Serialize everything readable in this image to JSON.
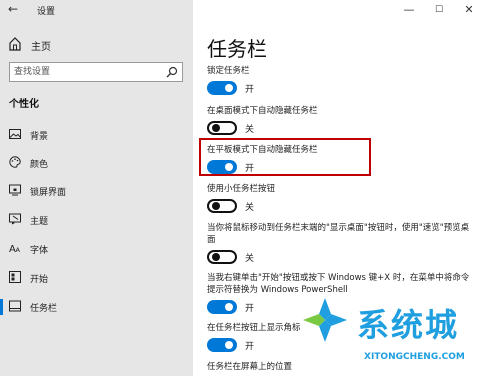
{
  "window": {
    "title": "设置",
    "back_icon": "back-arrow-icon"
  },
  "sidebar": {
    "home_label": "主页",
    "search_placeholder": "查找设置",
    "section_title": "个性化",
    "items": [
      {
        "label": "背景",
        "icon": "image-icon"
      },
      {
        "label": "颜色",
        "icon": "palette-icon"
      },
      {
        "label": "锁屏界面",
        "icon": "lock-screen-icon"
      },
      {
        "label": "主题",
        "icon": "theme-icon"
      },
      {
        "label": "字体",
        "icon": "font-icon"
      },
      {
        "label": "开始",
        "icon": "start-icon"
      },
      {
        "label": "任务栏",
        "icon": "taskbar-icon",
        "selected": true
      }
    ]
  },
  "main": {
    "title": "任务栏",
    "settings": [
      {
        "label": "锁定任务栏",
        "state": "开",
        "on": true
      },
      {
        "label": "在桌面模式下自动隐藏任务栏",
        "state": "关",
        "on": false
      },
      {
        "label": "在平板模式下自动隐藏任务栏",
        "state": "开",
        "on": true,
        "highlighted": true
      },
      {
        "label": "使用小任务栏按钮",
        "state": "关",
        "on": false
      },
      {
        "label": "当你将鼠标移动到任务栏末端的\"显示桌面\"按钮时，使用\"速览\"预览桌面",
        "state": "关",
        "on": false
      },
      {
        "label": "当我右键单击\"开始\"按钮或按下 Windows 键+X 时，在菜单中将命令提示符替换为 Windows PowerShell",
        "state": "开",
        "on": true
      },
      {
        "label": "在任务栏按钮上显示角标",
        "state": "开",
        "on": true
      },
      {
        "label": "任务栏在屏幕上的位置"
      }
    ]
  },
  "watermark": {
    "text": "系统城",
    "url": "XITONGCHENG.COM",
    "color": "#1f9fe0"
  },
  "colors": {
    "accent": "#0078d7",
    "highlight": "#c00000",
    "sidebar_bg": "#e6e6e6"
  }
}
